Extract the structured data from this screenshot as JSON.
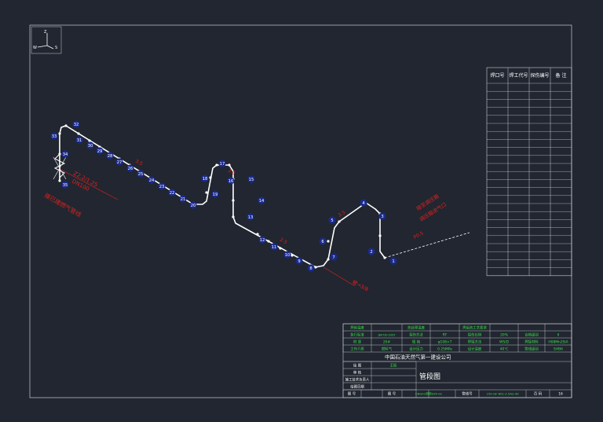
{
  "axis_indicator": {
    "up": "Z",
    "west": "W",
    "south": "S"
  },
  "weld_table": {
    "headers": [
      "焊口号",
      "焊工代号",
      "探伤编号",
      "备 注"
    ]
  },
  "weld_points": [
    "1",
    "2",
    "3",
    "4",
    "5",
    "6",
    "7",
    "8",
    "9",
    "10",
    "11",
    "12",
    "13",
    "14",
    "15",
    "16",
    "17",
    "18",
    "19",
    "20",
    "21",
    "22",
    "23",
    "24",
    "25",
    "26",
    "27",
    "28",
    "29",
    "30",
    "31",
    "32",
    "33",
    "34",
    "35"
  ],
  "annotations": {
    "origin_left": "接已建燃气管线",
    "elevation_left": "Z2.2/1.25",
    "dimension_left": "DN100",
    "segment_top": "3.5",
    "segment_mid": "3.0",
    "segment_bottom": "2.5",
    "segment_right": "3.5",
    "link_right": "接至调压箱",
    "link_right_2": "调压箱进气口",
    "right_tag": "P0.5",
    "bottom_slope": "坡→3/8"
  },
  "title_block": {
    "spec_rows": [
      [
        "焊前温度",
        "",
        "热处理温度",
        "",
        "焊后热工艺要求",
        ""
      ],
      [
        "执行标准",
        "JB4730-2005",
        "探伤方法",
        "RT",
        "探伤比例",
        "20%",
        "合格级别",
        "II"
      ],
      [
        "材  质",
        "20#",
        "规  格",
        "φ108×7",
        "焊接方法",
        "WS/D",
        "焊接材料",
        "H08Mn2SiA"
      ],
      [
        "工作介质",
        "燃料气",
        "设计压力",
        "0.25MPa",
        "设计温度",
        "40℃",
        "管线级别",
        "SHB6"
      ]
    ],
    "company": "中国石油天然气第一建设公司",
    "drawing_title": "管段图",
    "roles": [
      {
        "role": "绘 图",
        "name": "王振"
      },
      {
        "role": "审 核",
        "name": ""
      },
      {
        "role": "施工技术负责人",
        "name": ""
      },
      {
        "role": "绘图日期",
        "name": ""
      }
    ],
    "footer": {
      "label_1": "图 号",
      "value_1": "",
      "label_2": "图 号",
      "value_2": "CNG01测项035-01",
      "label_3": "管线号",
      "value_3": "150-GF-601-2.5A2-40",
      "label_4": "页 码",
      "value_4": "16"
    }
  },
  "colors": {
    "background": "#212630",
    "frame": "#c9cdd3",
    "pipe": "#ffffff",
    "annotation": "#e0201e",
    "table_green": "#38e04a",
    "weld_marker": "#1a2a8c"
  }
}
